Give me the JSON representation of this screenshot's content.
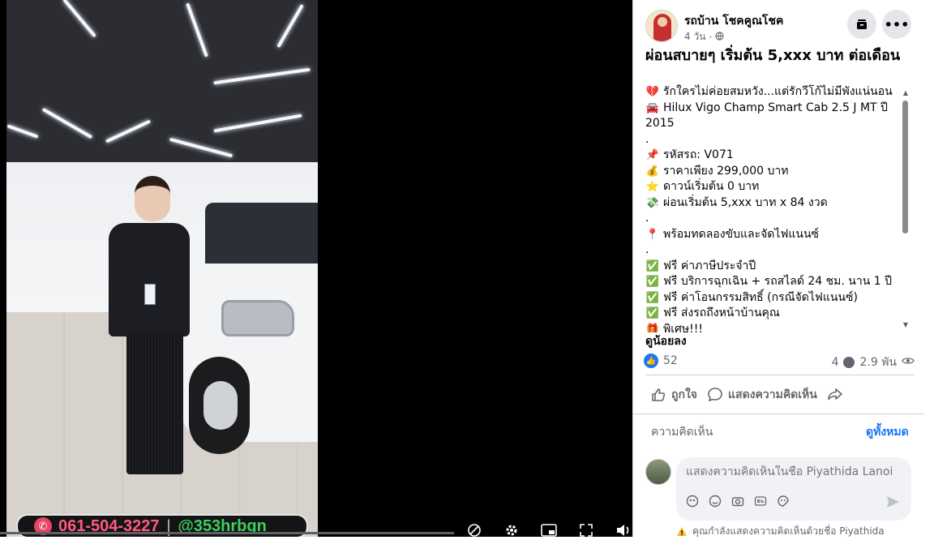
{
  "video": {
    "phone_number": "061-504-3227",
    "separator": "|",
    "line_id": "@353hrbgn"
  },
  "post": {
    "page_name": "รถบ้าน โชคคูณโชค",
    "time": "4 วัน",
    "dot": "·",
    "title": "ผ่อนสบายๆ เริ่มต้น 5,xxx บาท ต่อเดือน",
    "body": [
      {
        "emoji": "💔",
        "text": "รักใครไม่ค่อยสมหวัง...แต่รักวีโก้ไม่มีพังแน่นอน"
      },
      {
        "emoji": "🚘",
        "text": "Hilux Vigo Champ Smart Cab 2.5 J MT ปี 2015",
        "wrap": true
      },
      {
        "emoji": "",
        "text": "."
      },
      {
        "emoji": "📌",
        "text": "รหัสรถ: V071"
      },
      {
        "emoji": "💰",
        "text": "ราคาเพียง 299,000 บาท"
      },
      {
        "emoji": "⭐",
        "text": "ดาวน์เริ่มต้น 0 บาท"
      },
      {
        "emoji": "💸",
        "text": "ผ่อนเริ่มต้น 5,xxx บาท x 84 งวด"
      },
      {
        "emoji": "",
        "text": "."
      },
      {
        "emoji": "📍",
        "text": "พร้อมทดลองขับและจัดไฟแนนซ์"
      },
      {
        "emoji": "",
        "text": "."
      },
      {
        "emoji": "✅",
        "text": "ฟรี ค่าภาษีประจำปี"
      },
      {
        "emoji": "✅",
        "text": "ฟรี บริการฉุกเฉิน + รถสไลด์ 24 ชม. นาน 1 ปี"
      },
      {
        "emoji": "✅",
        "text": "ฟรี ค่าโอนกรรมสิทธิ์ (กรณีจัดไฟแนนซ์)"
      },
      {
        "emoji": "✅",
        "text": "ฟรี ส่งรถถึงหน้าบ้านคุณ"
      },
      {
        "emoji": "🎁",
        "text": "พิเศษ!!!"
      }
    ],
    "see_less": "ดูน้อยลง",
    "like_count": "52",
    "comment_count": "4",
    "view_count": "2.9 พัน"
  },
  "actions": {
    "like": "ถูกใจ",
    "comment": "แสดงความคิดเห็น"
  },
  "comments": {
    "label": "ความคิดเห็น",
    "see_all": "ดูทั้งหมด",
    "placeholder": "แสดงความคิดเห็นในชื่อ Piyathida Lanoi",
    "warning": "คุณกำลังแสดงความคิดเห็นด้วยชื่อ Piyathida"
  },
  "colors": {
    "accent": "#1877f2",
    "phone_pink": "#ff5a7a",
    "line_green": "#3bd15c"
  }
}
